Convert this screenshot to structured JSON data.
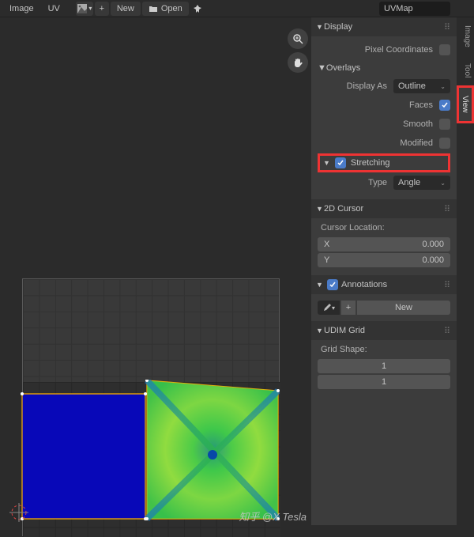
{
  "header": {
    "menus": [
      "Image",
      "UV"
    ],
    "image_icon": "image-icon",
    "plus": "+",
    "new_btn": "New",
    "open_btn": "Open",
    "pin_icon": "pin-icon",
    "uvmap_field": "UVMap"
  },
  "viewport": {
    "zoom_icon": "magnify-plus",
    "pan_icon": "hand"
  },
  "tabs": {
    "items": [
      "Image",
      "Tool",
      "View"
    ],
    "active": 2
  },
  "panel": {
    "display": {
      "title": "Display",
      "pixel_coords": {
        "label": "Pixel Coordinates",
        "checked": false
      },
      "overlays": {
        "title": "Overlays",
        "display_as": {
          "label": "Display As",
          "value": "Outline"
        },
        "faces": {
          "label": "Faces",
          "checked": true
        },
        "smooth": {
          "label": "Smooth",
          "checked": false
        },
        "modified": {
          "label": "Modified",
          "checked": false
        },
        "stretching": {
          "label": "Stretching",
          "checked": true,
          "type_label": "Type",
          "type_value": "Angle"
        }
      }
    },
    "cursor": {
      "title": "2D Cursor",
      "loc_label": "Cursor Location:",
      "x": {
        "k": "X",
        "v": "0.000"
      },
      "y": {
        "k": "Y",
        "v": "0.000"
      }
    },
    "annotations": {
      "title": "Annotations",
      "checked": true,
      "new_btn": "New",
      "plus": "+"
    },
    "udim": {
      "title": "UDIM Grid",
      "shape_label": "Grid Shape:",
      "x": "1",
      "y": "1"
    }
  },
  "watermark": "知乎 @X Tesla"
}
